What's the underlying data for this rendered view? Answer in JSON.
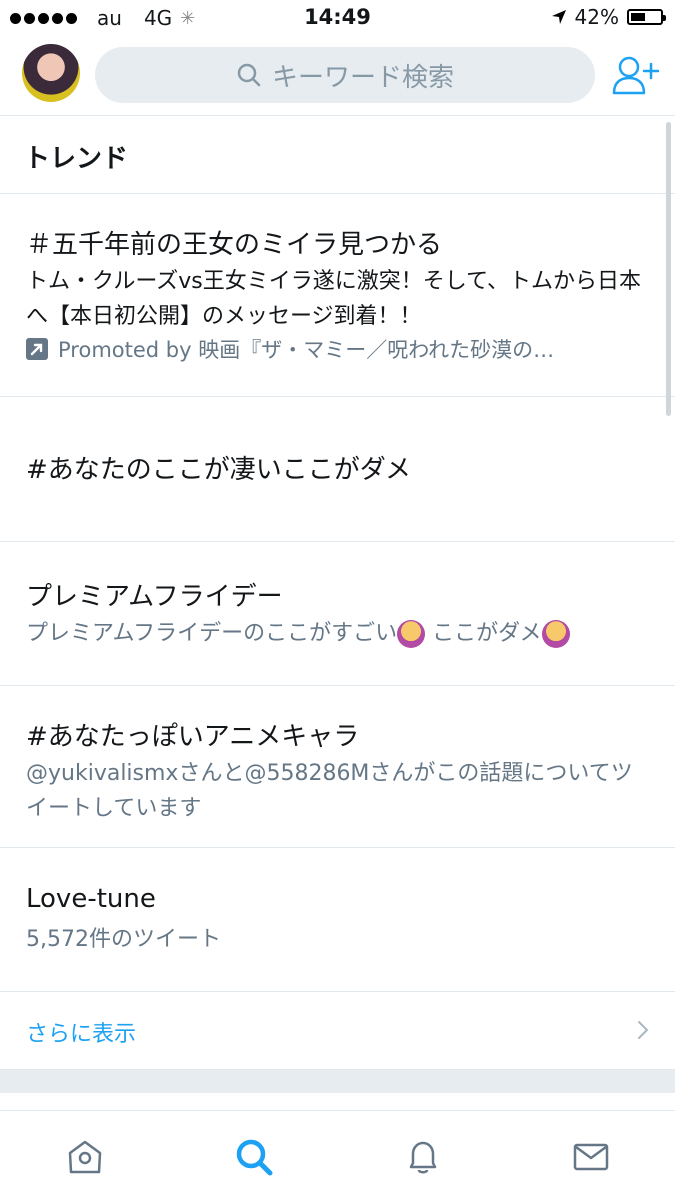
{
  "status_bar": {
    "carrier": "au",
    "network": "4G",
    "time": "14:49",
    "battery": "42%"
  },
  "search": {
    "placeholder": "キーワード検索",
    "icon": "search-icon"
  },
  "trends_section": {
    "heading": "トレンド"
  },
  "trends": [
    {
      "title": "＃五千年前の王女のミイラ見つかる",
      "description": "トム・クルーズvs王女ミイラ遂に激突！そして、トムから日本へ【本日初公開】のメッセージ到着！！",
      "promoted": "Promoted by 映画『ザ・マミー／呪われた砂漠の…"
    },
    {
      "title": "#あなたのここが凄いここがダメ"
    },
    {
      "title": "プレミアムフライデー",
      "context_a": "プレミアムフライデーのここがすごい",
      "context_b": "ここがダメ"
    },
    {
      "title": "#あなたっぽいアニメキャラ",
      "context": "@yukivalismxさんと@558286Mさんがこの話題についてツイートしています"
    },
    {
      "title": "Love-tune",
      "count": "5,572件のツイート"
    }
  ],
  "show_more": {
    "label": "さらに表示"
  },
  "tab_bar": {
    "items": [
      "home-icon",
      "search-icon",
      "notifications-icon",
      "messages-icon"
    ],
    "active": "search-icon"
  },
  "colors": {
    "accent": "#1da1f2",
    "secondary_text": "#657786",
    "separator": "#e1e8ed",
    "search_bg": "#e6ecf0"
  }
}
